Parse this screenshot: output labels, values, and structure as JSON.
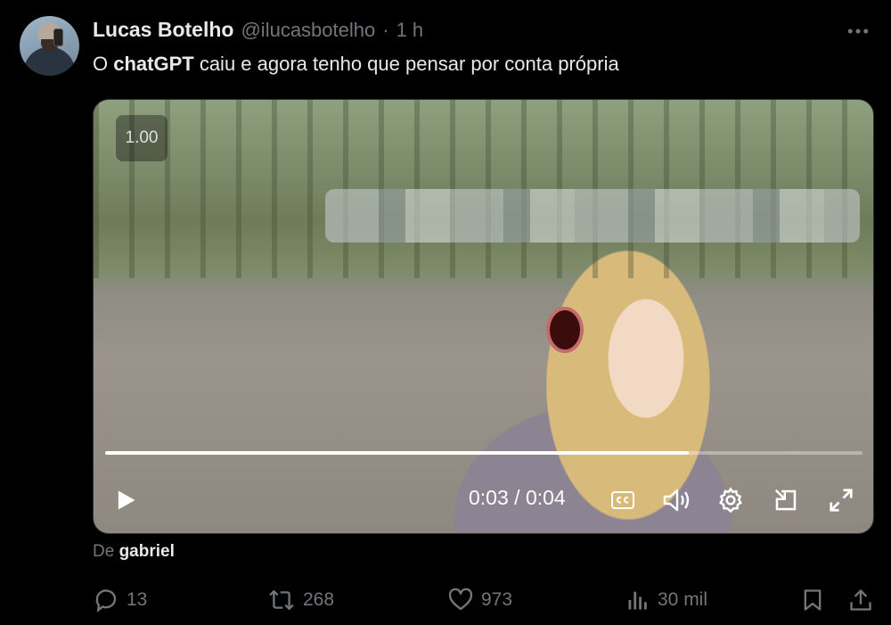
{
  "author": {
    "name": "Lucas Botelho",
    "handle": "@ilucasbotelho",
    "separator": "·",
    "time": "1 h"
  },
  "tweet": {
    "text_before": "O ",
    "text_bold": "chatGPT",
    "text_after": " caiu e agora tenho que pensar por conta própria"
  },
  "video": {
    "speed_label": "1.00",
    "current_time": "0:03",
    "time_separator": "/",
    "duration": "0:04",
    "progress_fraction": 0.77
  },
  "source": {
    "prefix": "De",
    "name": "gabriel"
  },
  "actions": {
    "replies": "13",
    "reposts": "268",
    "likes": "973",
    "views": "30 mil"
  },
  "icons": {
    "more": "more-dots-icon",
    "play": "play-icon",
    "captions": "captions-icon",
    "volume": "volume-icon",
    "settings": "gear-icon",
    "pip": "picture-in-picture-icon",
    "fullscreen": "fullscreen-icon",
    "reply": "reply-icon",
    "repost": "repost-icon",
    "like": "heart-icon",
    "views": "views-chart-icon",
    "bookmark": "bookmark-icon",
    "share": "share-icon"
  },
  "colors": {
    "background": "#000000",
    "text": "#e7e9ea",
    "muted": "#71767b"
  }
}
